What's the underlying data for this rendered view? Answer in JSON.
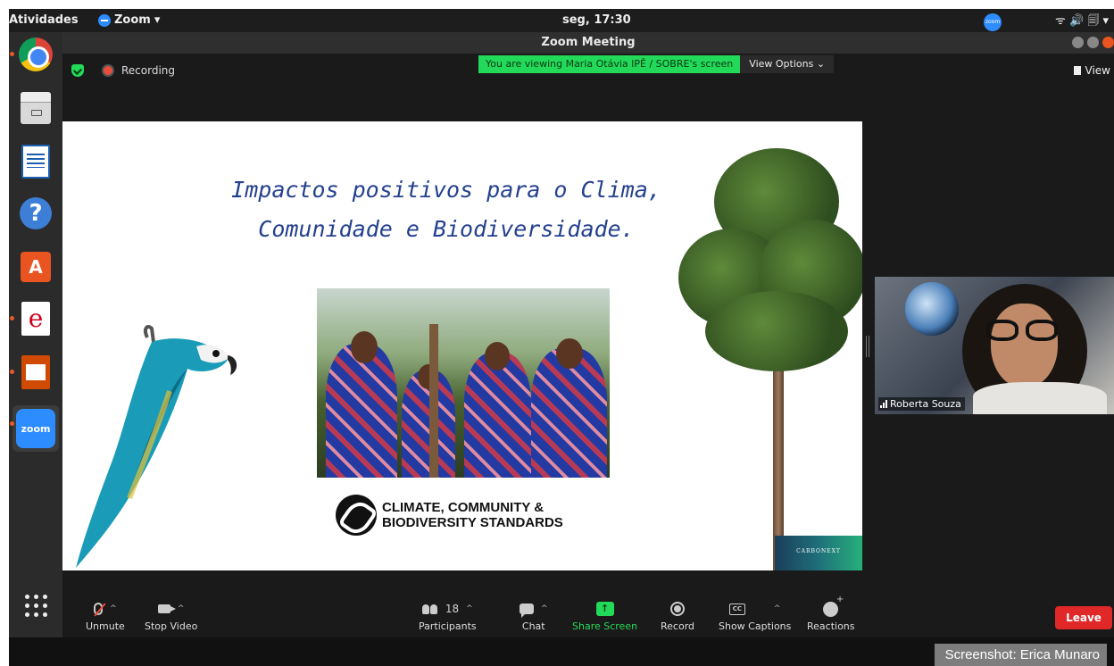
{
  "topbar": {
    "activities": "Atividades",
    "app_name": "Zoom",
    "app_caret": "▾",
    "clock": "seg, 17:30",
    "tray_zoom": "zoom",
    "tray_icons": "ᯤ 🔊 🗐 ▾"
  },
  "dock": {
    "items": [
      {
        "name": "chrome-icon"
      },
      {
        "name": "files-icon"
      },
      {
        "name": "writer-icon"
      },
      {
        "name": "help-icon",
        "glyph": "?"
      },
      {
        "name": "software-store-icon",
        "glyph": "A"
      },
      {
        "name": "pdf-viewer-icon",
        "glyph": "e"
      },
      {
        "name": "impress-icon"
      },
      {
        "name": "zoom-icon",
        "glyph": "zoom"
      }
    ]
  },
  "window": {
    "title": "Zoom Meeting"
  },
  "share_banner": {
    "text": "You are viewing Maria Otávia IPÊ / SOBRE's screen",
    "view_options": "View Options ⌄"
  },
  "meeting": {
    "recording": "Recording",
    "view": "View"
  },
  "slide": {
    "title_line1": "Impactos positivos para o Clima,",
    "title_line2": "Comunidade e Biodiversidade.",
    "ccb_line1": "CLIMATE, COMMUNITY &",
    "ccb_line2": "BIODIVERSITY STANDARDS",
    "carbonext": "CARBONEXT"
  },
  "participant": {
    "name": "Roberta Souza"
  },
  "toolbar": {
    "unmute": "Unmute",
    "stop_video": "Stop Video",
    "participants": "Participants",
    "participant_count": "18",
    "chat": "Chat",
    "share_screen": "Share Screen",
    "record": "Record",
    "show_captions": "Show Captions",
    "reactions": "Reactions",
    "leave": "Leave",
    "caret": "^",
    "cc": "CC",
    "share_arrow": "↑"
  },
  "credit": "Screenshot:  Erica Munaro",
  "colors": {
    "zoom_blue": "#2d8cff",
    "share_green": "#23d959",
    "leave_red": "#e02828",
    "slide_title": "#24408e"
  }
}
